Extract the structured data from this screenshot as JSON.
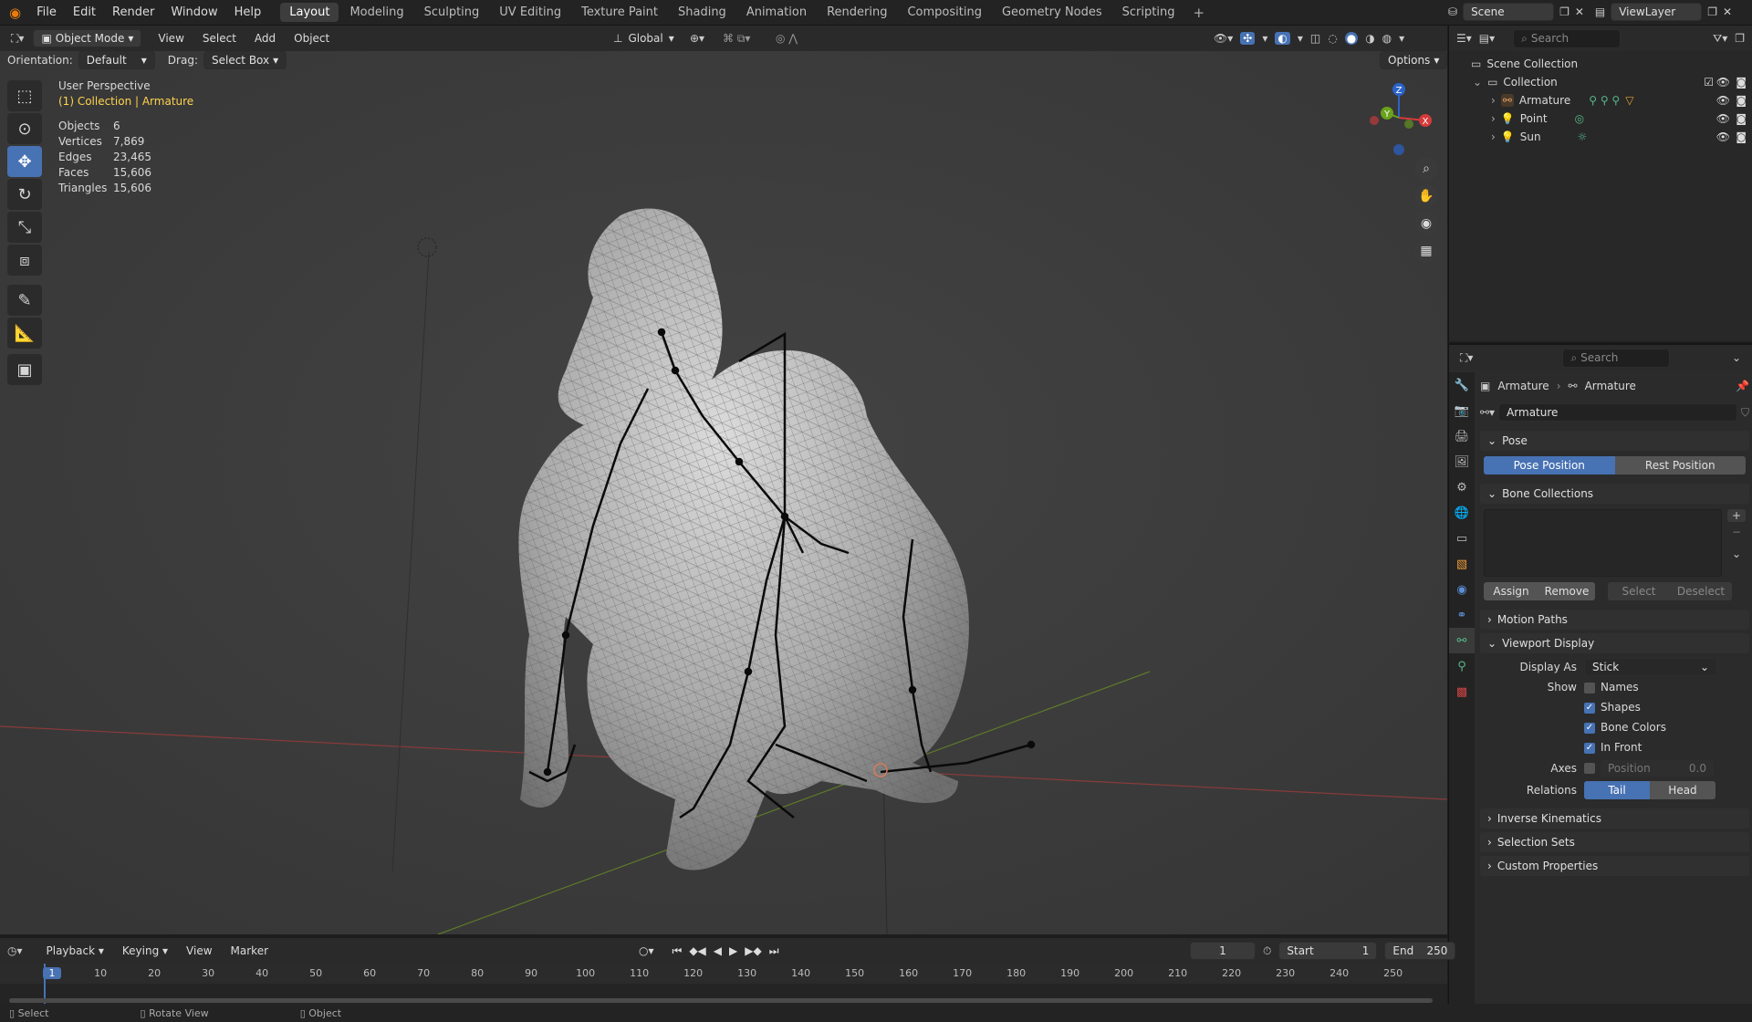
{
  "topbar": {
    "menus": [
      "File",
      "Edit",
      "Render",
      "Window",
      "Help"
    ],
    "workspaces": [
      "Layout",
      "Modeling",
      "Sculpting",
      "UV Editing",
      "Texture Paint",
      "Shading",
      "Animation",
      "Rendering",
      "Compositing",
      "Geometry Nodes",
      "Scripting"
    ],
    "active_workspace": "Layout",
    "scene": "Scene",
    "view_layer": "ViewLayer"
  },
  "viewport_header": {
    "mode": "Object Mode",
    "menus": [
      "View",
      "Select",
      "Add",
      "Object"
    ],
    "transform": "Global",
    "orientation_label": "Orientation:",
    "orientation_value": "Default",
    "drag_label": "Drag:",
    "drag_value": "Select Box",
    "options": "Options"
  },
  "overlay": {
    "view_name": "User Perspective",
    "context": "(1) Collection | Armature",
    "stats": [
      {
        "label": "Objects",
        "value": "6"
      },
      {
        "label": "Vertices",
        "value": "7,869"
      },
      {
        "label": "Edges",
        "value": "23,465"
      },
      {
        "label": "Faces",
        "value": "15,606"
      },
      {
        "label": "Triangles",
        "value": "15,606"
      }
    ]
  },
  "outliner": {
    "search_placeholder": "Search",
    "root": "Scene Collection",
    "collection": "Collection",
    "items": [
      "Armature",
      "Point",
      "Sun"
    ]
  },
  "properties": {
    "search_placeholder": "Search",
    "breadcrumb_object": "Armature",
    "breadcrumb_data": "Armature",
    "datablock_name": "Armature",
    "pose_panel": "Pose",
    "pose_position": "Pose Position",
    "rest_position": "Rest Position",
    "bone_collections": "Bone Collections",
    "assign": "Assign",
    "remove": "Remove",
    "select": "Select",
    "deselect": "Deselect",
    "motion_paths": "Motion Paths",
    "viewport_display": "Viewport Display",
    "display_as_label": "Display As",
    "display_as_value": "Stick",
    "show_label": "Show",
    "names": "Names",
    "shapes": "Shapes",
    "bone_colors": "Bone Colors",
    "in_front": "In Front",
    "axes_label": "Axes",
    "position_label": "Position",
    "position_value": "0.0",
    "relations_label": "Relations",
    "tail": "Tail",
    "head": "Head",
    "inverse_kinematics": "Inverse Kinematics",
    "selection_sets": "Selection Sets",
    "custom_properties": "Custom Properties"
  },
  "timeline": {
    "menus": [
      "Playback",
      "Keying",
      "View",
      "Marker"
    ],
    "current_frame": "1",
    "start_label": "Start",
    "start_value": "1",
    "end_label": "End",
    "end_value": "250",
    "ticks": [
      "1",
      "10",
      "20",
      "30",
      "40",
      "50",
      "60",
      "70",
      "80",
      "90",
      "100",
      "110",
      "120",
      "130",
      "140",
      "150",
      "160",
      "170",
      "180",
      "190",
      "200",
      "210",
      "220",
      "230",
      "240",
      "250"
    ]
  },
  "statusbar": {
    "items": [
      "Select",
      "Rotate View",
      "Object"
    ]
  },
  "colors": {
    "accent": "#4772b3",
    "yellow_text": "#ffd34d",
    "viewport_bg": "#3d3d3d"
  }
}
